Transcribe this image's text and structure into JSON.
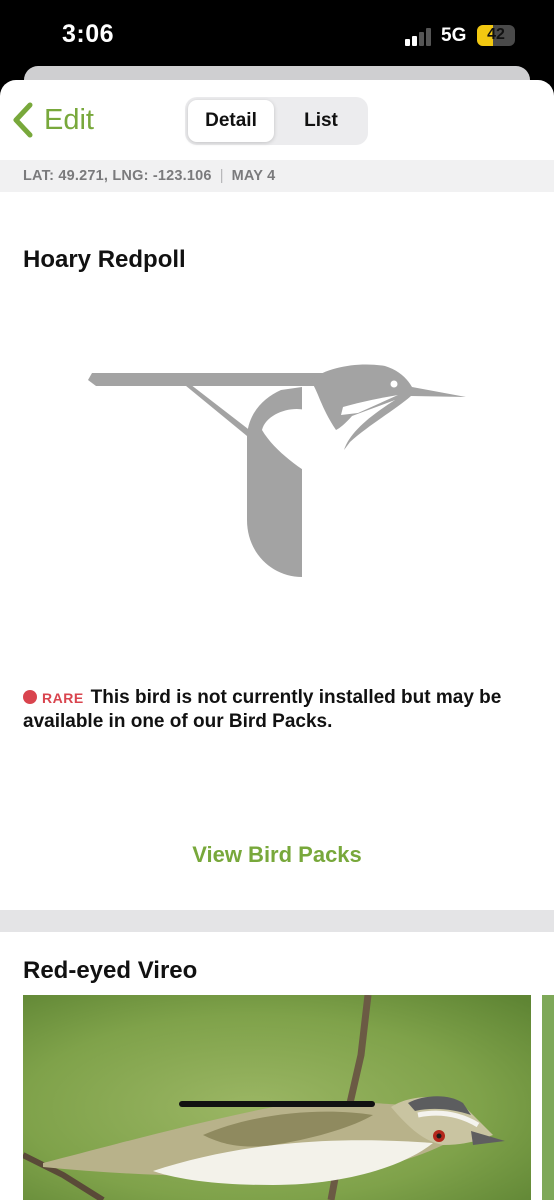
{
  "status": {
    "time": "3:06",
    "network": "5G",
    "battery": "42",
    "battery_level": 0.42
  },
  "nav": {
    "back_label": "Edit",
    "tabs": [
      {
        "label": "Detail",
        "selected": true
      },
      {
        "label": "List",
        "selected": false
      }
    ]
  },
  "location": {
    "coords": "LAT: 49.271, LNG: -123.106",
    "date": "MAY 4"
  },
  "birds": [
    {
      "name": "Hoary Redpoll",
      "image": "bird-silhouette-placeholder",
      "rarity_label": "RARE",
      "notice": "This bird is not currently installed but may be available in one of our Bird Packs.",
      "action": "View Bird Packs"
    },
    {
      "name": "Red-eyed Vireo",
      "image": "red-eyed-vireo-photo"
    }
  ],
  "colors": {
    "accent": "#78a83b",
    "rare": "#d9444e",
    "placeholder_gray": "#a3a3a3"
  }
}
